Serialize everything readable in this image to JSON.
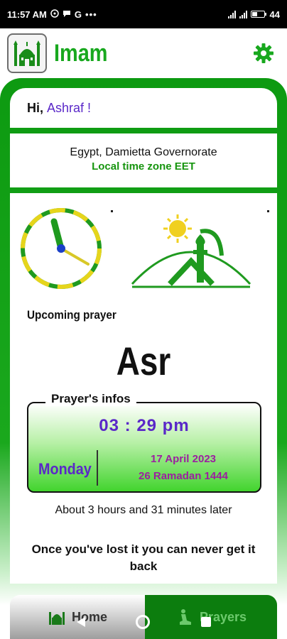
{
  "status_bar": {
    "time": "11:57 AM",
    "notification_icons": [
      "whatsapp-icon",
      "chat-icon",
      "google-icon",
      "more-dots-icon"
    ],
    "battery_text": "44"
  },
  "header": {
    "app_title": "Imam",
    "logo_icon": "mosque-icon",
    "settings_icon": "gear-icon"
  },
  "greeting": {
    "prefix": "Hi,",
    "name": "Ashraf !"
  },
  "location": {
    "place": "Egypt, Damietta Governorate",
    "timezone": "Local time zone EET"
  },
  "upcoming": {
    "label": "Upcoming prayer",
    "prayer_name": "Asr"
  },
  "prayer_info": {
    "legend": "Prayer's infos",
    "time": "03 : 29  pm",
    "day": "Monday",
    "gregorian_date": "17 April 2023",
    "hijri_date": "26 Ramadan 1444"
  },
  "remaining_text": "About 3 hours and 31 minutes later",
  "quote": "Once you've lost it you can never get it back",
  "bottom_nav": {
    "home_label": "Home",
    "prayers_label": "Prayers",
    "active": "Home"
  },
  "colors": {
    "primary_green": "#18a81e",
    "accent_purple": "#5a28c8",
    "date_magenta": "#9c1fa0"
  }
}
